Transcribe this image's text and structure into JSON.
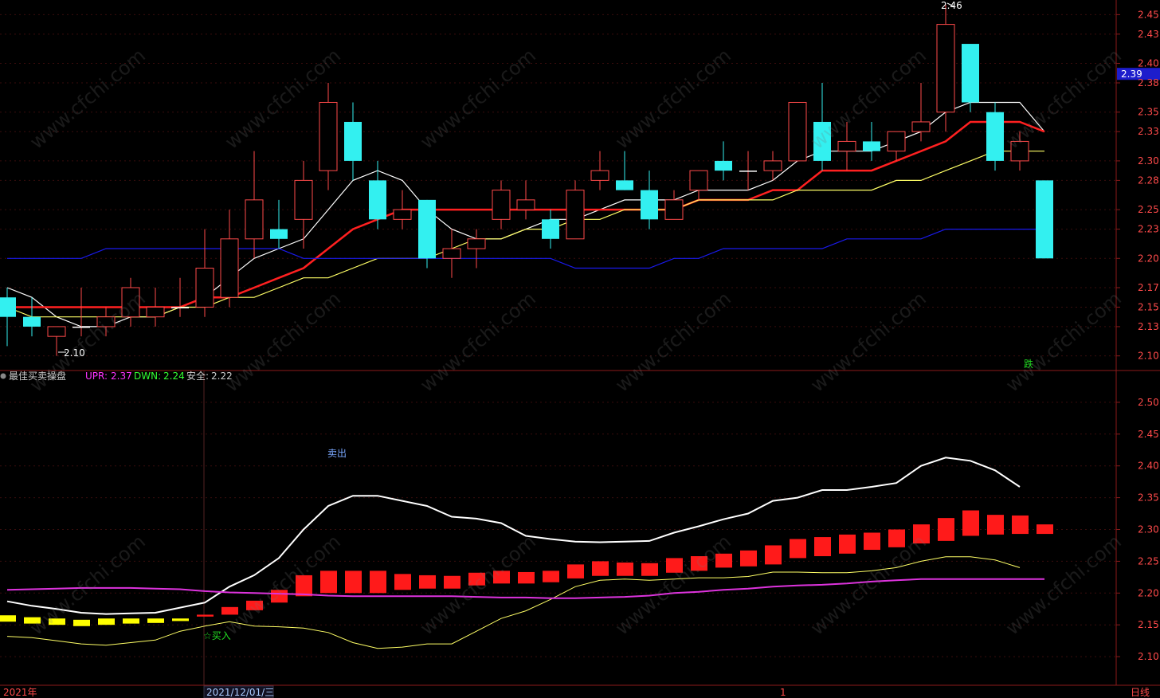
{
  "colors": {
    "background": "#000000",
    "axis": "#8b1a1a",
    "grid": "#3a0d0d",
    "up": "#ff4a4a",
    "down": "#33f0f0",
    "ma5": "#ffffff",
    "ma10": "#ff2020",
    "ma20": "#ffff66",
    "ma60": "#1a1aee",
    "axis_text": "#ff4a4a",
    "upr": "#ff33ff",
    "dwn": "#33ff33"
  },
  "watermark": "www.cfchi.com",
  "bottom_bar": {
    "left": "2021年",
    "date": "2021/12/01/三",
    "mark": "1",
    "period": "日线"
  },
  "chart_data": [
    {
      "type": "candlestick",
      "title": "",
      "ylim": [
        2.085,
        2.465
      ],
      "yticks": [
        "2.45",
        "2.43",
        "2.40",
        "2.38",
        "2.35",
        "2.33",
        "2.30",
        "2.28",
        "2.25",
        "2.23",
        "2.20",
        "2.17",
        "2.15",
        "2.13",
        "2.10"
      ],
      "current_price_label": "2.39",
      "current_price": 2.388,
      "annotations": {
        "high_label": "2.46",
        "low_label": "2.10",
        "signal_label": "跌"
      },
      "candles": [
        {
          "o": 2.16,
          "h": 2.17,
          "l": 2.11,
          "c": 2.14
        },
        {
          "o": 2.14,
          "h": 2.16,
          "l": 2.12,
          "c": 2.13
        },
        {
          "o": 2.12,
          "h": 2.13,
          "l": 2.1,
          "c": 2.13
        },
        {
          "o": 2.13,
          "h": 2.17,
          "l": 2.12,
          "c": 2.13
        },
        {
          "o": 2.13,
          "h": 2.15,
          "l": 2.12,
          "c": 2.14
        },
        {
          "o": 2.14,
          "h": 2.18,
          "l": 2.13,
          "c": 2.17
        },
        {
          "o": 2.14,
          "h": 2.17,
          "l": 2.13,
          "c": 2.15
        },
        {
          "o": 2.15,
          "h": 2.18,
          "l": 2.14,
          "c": 2.15
        },
        {
          "o": 2.15,
          "h": 2.23,
          "l": 2.14,
          "c": 2.19
        },
        {
          "o": 2.16,
          "h": 2.25,
          "l": 2.15,
          "c": 2.22
        },
        {
          "o": 2.22,
          "h": 2.31,
          "l": 2.2,
          "c": 2.26
        },
        {
          "o": 2.23,
          "h": 2.26,
          "l": 2.21,
          "c": 2.22
        },
        {
          "o": 2.24,
          "h": 2.3,
          "l": 2.21,
          "c": 2.28
        },
        {
          "o": 2.29,
          "h": 2.38,
          "l": 2.27,
          "c": 2.36
        },
        {
          "o": 2.34,
          "h": 2.36,
          "l": 2.28,
          "c": 2.3
        },
        {
          "o": 2.28,
          "h": 2.3,
          "l": 2.23,
          "c": 2.24
        },
        {
          "o": 2.24,
          "h": 2.27,
          "l": 2.23,
          "c": 2.25
        },
        {
          "o": 2.26,
          "h": 2.26,
          "l": 2.19,
          "c": 2.2
        },
        {
          "o": 2.2,
          "h": 2.23,
          "l": 2.18,
          "c": 2.21
        },
        {
          "o": 2.21,
          "h": 2.23,
          "l": 2.19,
          "c": 2.22
        },
        {
          "o": 2.24,
          "h": 2.28,
          "l": 2.23,
          "c": 2.27
        },
        {
          "o": 2.25,
          "h": 2.28,
          "l": 2.24,
          "c": 2.26
        },
        {
          "o": 2.24,
          "h": 2.25,
          "l": 2.21,
          "c": 2.22
        },
        {
          "o": 2.22,
          "h": 2.28,
          "l": 2.22,
          "c": 2.27
        },
        {
          "o": 2.28,
          "h": 2.31,
          "l": 2.27,
          "c": 2.29
        },
        {
          "o": 2.28,
          "h": 2.31,
          "l": 2.27,
          "c": 2.27
        },
        {
          "o": 2.27,
          "h": 2.29,
          "l": 2.23,
          "c": 2.24
        },
        {
          "o": 2.24,
          "h": 2.27,
          "l": 2.24,
          "c": 2.26
        },
        {
          "o": 2.27,
          "h": 2.29,
          "l": 2.26,
          "c": 2.29
        },
        {
          "o": 2.3,
          "h": 2.32,
          "l": 2.28,
          "c": 2.29
        },
        {
          "o": 2.29,
          "h": 2.31,
          "l": 2.27,
          "c": 2.29
        },
        {
          "o": 2.29,
          "h": 2.31,
          "l": 2.28,
          "c": 2.3
        },
        {
          "o": 2.3,
          "h": 2.36,
          "l": 2.3,
          "c": 2.36
        },
        {
          "o": 2.34,
          "h": 2.38,
          "l": 2.29,
          "c": 2.3
        },
        {
          "o": 2.31,
          "h": 2.34,
          "l": 2.29,
          "c": 2.32
        },
        {
          "o": 2.32,
          "h": 2.34,
          "l": 2.3,
          "c": 2.31
        },
        {
          "o": 2.31,
          "h": 2.33,
          "l": 2.3,
          "c": 2.33
        },
        {
          "o": 2.33,
          "h": 2.38,
          "l": 2.32,
          "c": 2.34
        },
        {
          "o": 2.35,
          "h": 2.46,
          "l": 2.33,
          "c": 2.44
        },
        {
          "o": 2.42,
          "h": 2.42,
          "l": 2.35,
          "c": 2.36
        },
        {
          "o": 2.35,
          "h": 2.36,
          "l": 2.29,
          "c": 2.3
        },
        {
          "o": 2.3,
          "h": 2.33,
          "l": 2.29,
          "c": 2.32
        },
        {
          "o": 2.28,
          "h": 2.28,
          "l": 2.2,
          "c": 2.2
        }
      ],
      "series": [
        {
          "key": "ma5",
          "values": [
            2.17,
            2.16,
            2.14,
            2.13,
            2.13,
            2.14,
            2.14,
            2.15,
            2.16,
            2.18,
            2.2,
            2.21,
            2.22,
            2.25,
            2.28,
            2.29,
            2.28,
            2.25,
            2.23,
            2.22,
            2.22,
            2.23,
            2.24,
            2.24,
            2.25,
            2.26,
            2.26,
            2.26,
            2.27,
            2.27,
            2.27,
            2.28,
            2.3,
            2.31,
            2.31,
            2.31,
            2.32,
            2.33,
            2.35,
            2.36,
            2.36,
            2.36,
            2.33
          ]
        },
        {
          "key": "ma10",
          "values": [
            2.15,
            2.15,
            2.15,
            2.15,
            2.15,
            2.15,
            2.15,
            2.15,
            2.16,
            2.16,
            2.17,
            2.18,
            2.19,
            2.21,
            2.23,
            2.24,
            2.25,
            2.25,
            2.25,
            2.25,
            2.25,
            2.25,
            2.25,
            2.25,
            2.25,
            2.25,
            2.25,
            2.25,
            2.26,
            2.26,
            2.26,
            2.27,
            2.27,
            2.29,
            2.29,
            2.29,
            2.3,
            2.31,
            2.32,
            2.34,
            2.34,
            2.34,
            2.33
          ]
        },
        {
          "key": "ma20",
          "values": [
            2.15,
            2.14,
            2.14,
            2.14,
            2.14,
            2.14,
            2.14,
            2.15,
            2.15,
            2.16,
            2.16,
            2.17,
            2.18,
            2.18,
            2.19,
            2.2,
            2.2,
            2.2,
            2.21,
            2.22,
            2.22,
            2.23,
            2.23,
            2.24,
            2.24,
            2.25,
            2.25,
            2.25,
            2.26,
            2.26,
            2.26,
            2.26,
            2.27,
            2.27,
            2.27,
            2.27,
            2.28,
            2.28,
            2.29,
            2.3,
            2.31,
            2.31,
            2.31
          ]
        },
        {
          "key": "ma60",
          "values": [
            2.2,
            2.2,
            2.2,
            2.2,
            2.21,
            2.21,
            2.21,
            2.21,
            2.21,
            2.21,
            2.21,
            2.21,
            2.2,
            2.2,
            2.2,
            2.2,
            2.2,
            2.2,
            2.2,
            2.2,
            2.2,
            2.2,
            2.2,
            2.19,
            2.19,
            2.19,
            2.19,
            2.2,
            2.2,
            2.21,
            2.21,
            2.21,
            2.21,
            2.21,
            2.22,
            2.22,
            2.22,
            2.22,
            2.23,
            2.23,
            2.23,
            2.23,
            2.23
          ]
        }
      ]
    },
    {
      "type": "indicator",
      "title": "最佳买卖操盘",
      "values_header": {
        "upr_label": "UPR:",
        "upr": "2.37",
        "dwn_label": "DWN:",
        "dwn": "2.24",
        "safe_label": "安全:",
        "safe": "2.22"
      },
      "ylim": [
        2.055,
        2.55
      ],
      "yticks": [
        "2.50",
        "2.45",
        "2.40",
        "2.35",
        "2.30",
        "2.25",
        "2.20",
        "2.15",
        "2.10"
      ],
      "annotations": {
        "sell_label": "卖出",
        "buy_label": "☆买入"
      },
      "bars": [
        {
          "lo": 2.155,
          "hi": 2.165,
          "color": "yellow"
        },
        {
          "lo": 2.152,
          "hi": 2.162,
          "color": "yellow"
        },
        {
          "lo": 2.15,
          "hi": 2.16,
          "color": "yellow"
        },
        {
          "lo": 2.148,
          "hi": 2.158,
          "color": "yellow"
        },
        {
          "lo": 2.15,
          "hi": 2.16,
          "color": "yellow"
        },
        {
          "lo": 2.152,
          "hi": 2.16,
          "color": "yellow"
        },
        {
          "lo": 2.153,
          "hi": 2.16,
          "color": "yellow"
        },
        {
          "lo": 2.156,
          "hi": 2.16,
          "color": "yellow"
        },
        {
          "lo": 2.163,
          "hi": 2.166,
          "color": "red"
        },
        {
          "lo": 2.166,
          "hi": 2.178,
          "color": "red"
        },
        {
          "lo": 2.173,
          "hi": 2.188,
          "color": "red"
        },
        {
          "lo": 2.185,
          "hi": 2.205,
          "color": "red"
        },
        {
          "lo": 2.195,
          "hi": 2.228,
          "color": "red"
        },
        {
          "lo": 2.2,
          "hi": 2.235,
          "color": "red"
        },
        {
          "lo": 2.2,
          "hi": 2.235,
          "color": "red"
        },
        {
          "lo": 2.2,
          "hi": 2.235,
          "color": "red"
        },
        {
          "lo": 2.205,
          "hi": 2.23,
          "color": "red"
        },
        {
          "lo": 2.207,
          "hi": 2.228,
          "color": "red"
        },
        {
          "lo": 2.207,
          "hi": 2.227,
          "color": "red"
        },
        {
          "lo": 2.212,
          "hi": 2.232,
          "color": "red"
        },
        {
          "lo": 2.215,
          "hi": 2.235,
          "color": "red"
        },
        {
          "lo": 2.215,
          "hi": 2.233,
          "color": "red"
        },
        {
          "lo": 2.217,
          "hi": 2.235,
          "color": "red"
        },
        {
          "lo": 2.223,
          "hi": 2.245,
          "color": "red"
        },
        {
          "lo": 2.227,
          "hi": 2.25,
          "color": "red"
        },
        {
          "lo": 2.227,
          "hi": 2.248,
          "color": "red"
        },
        {
          "lo": 2.227,
          "hi": 2.247,
          "color": "red"
        },
        {
          "lo": 2.232,
          "hi": 2.255,
          "color": "red"
        },
        {
          "lo": 2.235,
          "hi": 2.258,
          "color": "red"
        },
        {
          "lo": 2.24,
          "hi": 2.262,
          "color": "red"
        },
        {
          "lo": 2.242,
          "hi": 2.267,
          "color": "red"
        },
        {
          "lo": 2.245,
          "hi": 2.275,
          "color": "red"
        },
        {
          "lo": 2.255,
          "hi": 2.285,
          "color": "red"
        },
        {
          "lo": 2.258,
          "hi": 2.288,
          "color": "red"
        },
        {
          "lo": 2.262,
          "hi": 2.292,
          "color": "red"
        },
        {
          "lo": 2.268,
          "hi": 2.295,
          "color": "red"
        },
        {
          "lo": 2.272,
          "hi": 2.3,
          "color": "red"
        },
        {
          "lo": 2.278,
          "hi": 2.308,
          "color": "red"
        },
        {
          "lo": 2.282,
          "hi": 2.318,
          "color": "red"
        },
        {
          "lo": 2.29,
          "hi": 2.33,
          "color": "red"
        },
        {
          "lo": 2.292,
          "hi": 2.323,
          "color": "red"
        },
        {
          "lo": 2.293,
          "hi": 2.322,
          "color": "red"
        },
        {
          "lo": 2.293,
          "hi": 2.308,
          "color": "red"
        }
      ],
      "series": [
        {
          "key": "upr",
          "values": [
            2.187,
            2.18,
            2.175,
            2.169,
            2.167,
            2.168,
            2.169,
            2.177,
            2.185,
            2.21,
            2.228,
            2.255,
            2.3,
            2.337,
            2.353,
            2.353,
            2.345,
            2.337,
            2.32,
            2.317,
            2.31,
            2.29,
            2.285,
            2.281,
            2.28,
            2.281,
            2.282,
            2.295,
            2.305,
            2.316,
            2.325,
            2.345,
            2.35,
            2.362,
            2.362,
            2.367,
            2.373,
            2.4,
            2.413,
            2.408,
            2.393,
            2.367
          ]
        },
        {
          "key": "dwn",
          "values": [
            2.132,
            2.13,
            2.125,
            2.12,
            2.118,
            2.122,
            2.126,
            2.14,
            2.148,
            2.155,
            2.148,
            2.147,
            2.145,
            2.138,
            2.122,
            2.113,
            2.115,
            2.12,
            2.12,
            2.14,
            2.16,
            2.172,
            2.19,
            2.21,
            2.22,
            2.222,
            2.22,
            2.222,
            2.224,
            2.224,
            2.226,
            2.233,
            2.233,
            2.232,
            2.232,
            2.235,
            2.24,
            2.25,
            2.257,
            2.257,
            2.252,
            2.24
          ]
        },
        {
          "key": "safe",
          "values": [
            2.205,
            2.206,
            2.207,
            2.208,
            2.208,
            2.208,
            2.207,
            2.206,
            2.203,
            2.201,
            2.2,
            2.199,
            2.198,
            2.196,
            2.195,
            2.195,
            2.195,
            2.195,
            2.195,
            2.194,
            2.193,
            2.193,
            2.192,
            2.192,
            2.193,
            2.194,
            2.196,
            2.2,
            2.202,
            2.205,
            2.207,
            2.21,
            2.212,
            2.213,
            2.215,
            2.218,
            2.22,
            2.222,
            2.222,
            2.222,
            2.222,
            2.222,
            2.222
          ]
        }
      ]
    }
  ]
}
